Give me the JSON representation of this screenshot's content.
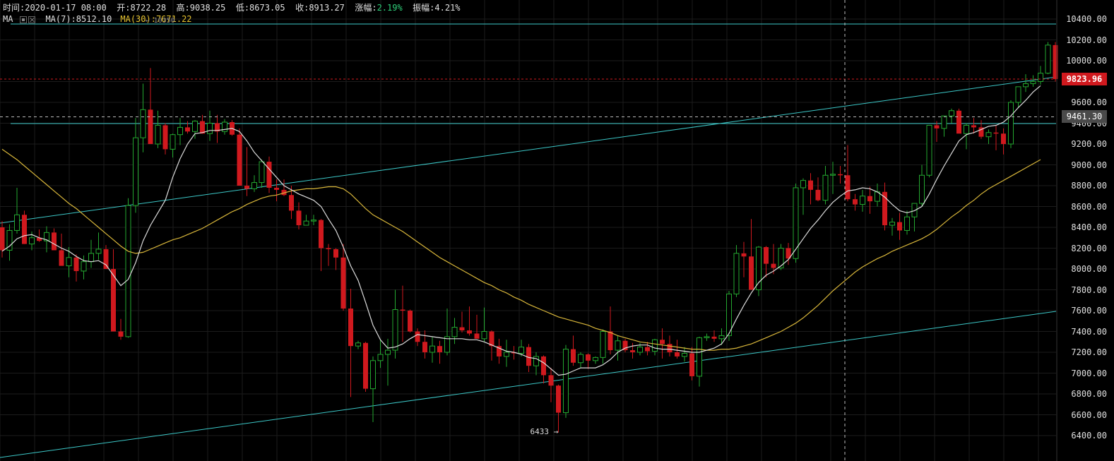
{
  "info_bar": {
    "time_label": "时间:",
    "time": "2020-01-17 08:00",
    "open_label": "开:",
    "open": "8722.28",
    "high_label": "高:",
    "high": "9038.25",
    "low_label": "低:",
    "low": "8673.05",
    "close_label": "收:",
    "close": "8913.27",
    "change_label": "涨幅:",
    "change": "2.19%",
    "amplitude_label": "振幅:",
    "amplitude": "4.21%"
  },
  "ma_bar": {
    "label": "MA",
    "ma7": "MA(7):8512.10",
    "ma30": "MA(30):7671.22"
  },
  "price_tag": "9823.96",
  "crosshair_tag": "9461.30",
  "low_marker": "6433",
  "high_marker": "10350",
  "colors": {
    "up": "#24a830",
    "down": "#d0191e",
    "ma7": "#dcdcdc",
    "ma30": "#d8b63a",
    "trendline": "#3cc8c8",
    "accent_green": "#2fd07a",
    "ma30_text": "#e6c330"
  },
  "chart_data": {
    "type": "candlestick",
    "ylim": [
      6300,
      10500
    ],
    "yticks": [
      6400,
      6600,
      6800,
      7000,
      7200,
      7400,
      7600,
      7800,
      8000,
      8200,
      8400,
      8600,
      8800,
      9000,
      9200,
      9400,
      9600,
      9800,
      10000,
      10200,
      10400
    ],
    "candles": [
      [
        8400,
        8460,
        8110,
        8180
      ],
      [
        8180,
        8430,
        8080,
        8370
      ],
      [
        8370,
        8780,
        8340,
        8520
      ],
      [
        8520,
        8560,
        8240,
        8240
      ],
      [
        8240,
        8360,
        8180,
        8300
      ],
      [
        8300,
        8380,
        8260,
        8270
      ],
      [
        8270,
        8410,
        8160,
        8350
      ],
      [
        8350,
        8390,
        8180,
        8180
      ],
      [
        8180,
        8340,
        8050,
        8030
      ],
      [
        8030,
        8210,
        7920,
        8110
      ],
      [
        8110,
        8140,
        7880,
        7980
      ],
      [
        7980,
        8130,
        7900,
        8070
      ],
      [
        8070,
        8280,
        8010,
        8150
      ],
      [
        8150,
        8350,
        8090,
        8190
      ],
      [
        8190,
        8230,
        8010,
        8000
      ],
      [
        8000,
        8190,
        7400,
        7400
      ],
      [
        7400,
        7520,
        7320,
        7350
      ],
      [
        7350,
        8680,
        7340,
        8610
      ],
      [
        8610,
        9450,
        8540,
        9260
      ],
      [
        9260,
        9780,
        9120,
        9530
      ],
      [
        9530,
        9930,
        9280,
        9200
      ],
      [
        9200,
        9520,
        9160,
        9380
      ],
      [
        9380,
        9400,
        9100,
        9150
      ],
      [
        9150,
        9300,
        9070,
        9290
      ],
      [
        9290,
        9450,
        9190,
        9360
      ],
      [
        9360,
        9420,
        9300,
        9320
      ],
      [
        9320,
        9430,
        9250,
        9420
      ],
      [
        9420,
        9480,
        9300,
        9300
      ],
      [
        9300,
        9520,
        9230,
        9400
      ],
      [
        9400,
        9480,
        9210,
        9320
      ],
      [
        9320,
        9440,
        9290,
        9410
      ],
      [
        9410,
        9430,
        9280,
        9290
      ],
      [
        9290,
        9350,
        8820,
        8800
      ],
      [
        8800,
        9170,
        8700,
        8770
      ],
      [
        8770,
        8900,
        8740,
        8830
      ],
      [
        8830,
        9050,
        8780,
        9030
      ],
      [
        9030,
        9080,
        8730,
        8780
      ],
      [
        8780,
        8860,
        8650,
        8760
      ],
      [
        8760,
        8860,
        8700,
        8710
      ],
      [
        8710,
        8800,
        8480,
        8560
      ],
      [
        8560,
        8640,
        8380,
        8420
      ],
      [
        8420,
        8520,
        8420,
        8460
      ],
      [
        8460,
        8520,
        8420,
        8470
      ],
      [
        8470,
        8480,
        7980,
        8200
      ],
      [
        8200,
        8240,
        8030,
        8190
      ],
      [
        8190,
        8200,
        7990,
        8110
      ],
      [
        8110,
        8240,
        7600,
        7620
      ],
      [
        7620,
        7810,
        6770,
        7260
      ],
      [
        7260,
        7310,
        7230,
        7290
      ],
      [
        7290,
        7300,
        6820,
        6850
      ],
      [
        6850,
        7160,
        6530,
        7120
      ],
      [
        7120,
        7320,
        7050,
        7180
      ],
      [
        7180,
        7330,
        6880,
        7220
      ],
      [
        7220,
        7800,
        7140,
        7610
      ],
      [
        7610,
        7840,
        7300,
        7600
      ],
      [
        7600,
        7610,
        7390,
        7400
      ],
      [
        7400,
        7430,
        7260,
        7300
      ],
      [
        7300,
        7410,
        7140,
        7200
      ],
      [
        7200,
        7350,
        7100,
        7260
      ],
      [
        7260,
        7310,
        7090,
        7200
      ],
      [
        7200,
        7620,
        7170,
        7350
      ],
      [
        7350,
        7530,
        7280,
        7440
      ],
      [
        7440,
        7590,
        7390,
        7410
      ],
      [
        7410,
        7640,
        7360,
        7380
      ],
      [
        7380,
        7560,
        7350,
        7330
      ],
      [
        7330,
        7630,
        7300,
        7400
      ],
      [
        7400,
        7410,
        7120,
        7260
      ],
      [
        7260,
        7330,
        7090,
        7160
      ],
      [
        7160,
        7320,
        7060,
        7200
      ],
      [
        7200,
        7260,
        7130,
        7190
      ],
      [
        7190,
        7320,
        7160,
        7250
      ],
      [
        7250,
        7280,
        7010,
        7070
      ],
      [
        7070,
        7200,
        6980,
        7160
      ],
      [
        7160,
        7170,
        6900,
        6980
      ],
      [
        6980,
        7050,
        6720,
        6880
      ],
      [
        6880,
        6890,
        6430,
        6620
      ],
      [
        6620,
        7270,
        6570,
        7230
      ],
      [
        7230,
        7360,
        7070,
        7100
      ],
      [
        7100,
        7200,
        7050,
        7180
      ],
      [
        7180,
        7190,
        7040,
        7120
      ],
      [
        7120,
        7160,
        7090,
        7150
      ],
      [
        7150,
        7420,
        7090,
        7400
      ],
      [
        7400,
        7640,
        7180,
        7220
      ],
      [
        7220,
        7360,
        7120,
        7310
      ],
      [
        7310,
        7330,
        7200,
        7220
      ],
      [
        7220,
        7290,
        7140,
        7200
      ],
      [
        7200,
        7290,
        7170,
        7250
      ],
      [
        7250,
        7300,
        7170,
        7210
      ],
      [
        7210,
        7330,
        7170,
        7320
      ],
      [
        7320,
        7430,
        7140,
        7280
      ],
      [
        7280,
        7360,
        7160,
        7200
      ],
      [
        7200,
        7320,
        7140,
        7160
      ],
      [
        7160,
        7250,
        7110,
        7190
      ],
      [
        7190,
        7250,
        6930,
        6970
      ],
      [
        6970,
        7350,
        6870,
        7340
      ],
      [
        7340,
        7380,
        7310,
        7350
      ],
      [
        7350,
        7410,
        7300,
        7330
      ],
      [
        7330,
        7430,
        7270,
        7360
      ],
      [
        7360,
        7790,
        7310,
        7760
      ],
      [
        7760,
        8230,
        7730,
        8150
      ],
      [
        8150,
        8260,
        7920,
        8120
      ],
      [
        8120,
        8480,
        7800,
        7800
      ],
      [
        7800,
        8220,
        7740,
        8210
      ],
      [
        8210,
        8220,
        7920,
        8050
      ],
      [
        8050,
        8240,
        7950,
        8010
      ],
      [
        8010,
        8240,
        7990,
        8200
      ],
      [
        8200,
        8250,
        8040,
        8100
      ],
      [
        8100,
        8820,
        8060,
        8780
      ],
      [
        8780,
        8870,
        8520,
        8850
      ],
      [
        8850,
        8920,
        8620,
        8760
      ],
      [
        8760,
        8880,
        8650,
        8660
      ],
      [
        8660,
        8990,
        8620,
        8900
      ],
      [
        8900,
        9030,
        8720,
        8910
      ],
      [
        8910,
        8990,
        8820,
        8900
      ],
      [
        8900,
        9190,
        8650,
        8670
      ],
      [
        8670,
        8720,
        8560,
        8620
      ],
      [
        8620,
        8760,
        8550,
        8700
      ],
      [
        8700,
        8790,
        8530,
        8650
      ],
      [
        8650,
        8820,
        8600,
        8740
      ],
      [
        8740,
        8830,
        8370,
        8420
      ],
      [
        8420,
        8490,
        8320,
        8450
      ],
      [
        8450,
        8540,
        8280,
        8370
      ],
      [
        8370,
        8560,
        8330,
        8500
      ],
      [
        8500,
        8630,
        8360,
        8630
      ],
      [
        8630,
        9000,
        8600,
        8900
      ],
      [
        8900,
        9380,
        8880,
        9380
      ],
      [
        9380,
        9420,
        9220,
        9350
      ],
      [
        9350,
        9470,
        9270,
        9470
      ],
      [
        9470,
        9540,
        9400,
        9520
      ],
      [
        9520,
        9540,
        9330,
        9300
      ],
      [
        9300,
        9400,
        9150,
        9380
      ],
      [
        9380,
        9450,
        9300,
        9360
      ],
      [
        9360,
        9430,
        9250,
        9270
      ],
      [
        9270,
        9340,
        9200,
        9310
      ],
      [
        9310,
        9380,
        9140,
        9300
      ],
      [
        9300,
        9350,
        9100,
        9200
      ],
      [
        9200,
        9620,
        9160,
        9600
      ],
      [
        9600,
        9750,
        9550,
        9750
      ],
      [
        9750,
        9870,
        9700,
        9780
      ],
      [
        9780,
        9860,
        9750,
        9800
      ],
      [
        9800,
        9950,
        9770,
        9880
      ],
      [
        9880,
        10180,
        9870,
        10150
      ],
      [
        10150,
        10180,
        9800,
        9823.96
      ]
    ],
    "ma7": [
      8170,
      8220,
      8290,
      8320,
      8330,
      8300,
      8280,
      8240,
      8200,
      8170,
      8120,
      8080,
      8070,
      8080,
      8040,
      7940,
      7840,
      7900,
      8060,
      8270,
      8420,
      8540,
      8660,
      8880,
      9060,
      9200,
      9300,
      9310,
      9330,
      9330,
      9340,
      9350,
      9320,
      9230,
      9120,
      9040,
      8960,
      8880,
      8800,
      8760,
      8720,
      8690,
      8660,
      8600,
      8480,
      8370,
      8210,
      8030,
      7890,
      7680,
      7460,
      7320,
      7240,
      7250,
      7280,
      7330,
      7370,
      7360,
      7350,
      7340,
      7330,
      7330,
      7330,
      7320,
      7320,
      7300,
      7270,
      7240,
      7210,
      7200,
      7180,
      7150,
      7140,
      7100,
      7040,
      6980,
      6990,
      7020,
      7050,
      7050,
      7050,
      7080,
      7130,
      7200,
      7240,
      7260,
      7270,
      7270,
      7240,
      7230,
      7230,
      7220,
      7210,
      7200,
      7200,
      7220,
      7240,
      7280,
      7380,
      7520,
      7650,
      7770,
      7870,
      7940,
      7980,
      8030,
      8090,
      8190,
      8290,
      8390,
      8470,
      8560,
      8640,
      8700,
      8750,
      8760,
      8780,
      8770,
      8740,
      8690,
      8620,
      8560,
      8540,
      8560,
      8600,
      8720,
      8860,
      8990,
      9110,
      9230,
      9290,
      9310,
      9340,
      9370,
      9380,
      9410,
      9470,
      9550,
      9620,
      9700,
      9760
    ],
    "ma30": [
      9150,
      9100,
      9050,
      8990,
      8930,
      8870,
      8810,
      8750,
      8690,
      8630,
      8580,
      8520,
      8460,
      8400,
      8340,
      8280,
      8220,
      8170,
      8150,
      8160,
      8190,
      8220,
      8250,
      8280,
      8300,
      8330,
      8360,
      8390,
      8430,
      8470,
      8510,
      8550,
      8580,
      8620,
      8650,
      8680,
      8700,
      8710,
      8730,
      8750,
      8760,
      8770,
      8770,
      8780,
      8790,
      8790,
      8770,
      8720,
      8650,
      8580,
      8520,
      8480,
      8440,
      8400,
      8360,
      8310,
      8260,
      8210,
      8160,
      8110,
      8070,
      8030,
      7990,
      7950,
      7910,
      7870,
      7840,
      7800,
      7770,
      7730,
      7700,
      7660,
      7630,
      7600,
      7570,
      7540,
      7520,
      7500,
      7480,
      7460,
      7430,
      7410,
      7390,
      7360,
      7340,
      7320,
      7300,
      7290,
      7280,
      7270,
      7260,
      7250,
      7240,
      7230,
      7230,
      7220,
      7220,
      7230,
      7230,
      7240,
      7260,
      7280,
      7310,
      7340,
      7370,
      7400,
      7440,
      7480,
      7530,
      7590,
      7650,
      7720,
      7790,
      7850,
      7910,
      7970,
      8020,
      8060,
      8100,
      8130,
      8170,
      8200,
      8230,
      8260,
      8290,
      8330,
      8380,
      8440,
      8500,
      8550,
      8610,
      8660,
      8720,
      8770,
      8810,
      8850,
      8890,
      8930,
      8970,
      9010,
      9050
    ]
  }
}
